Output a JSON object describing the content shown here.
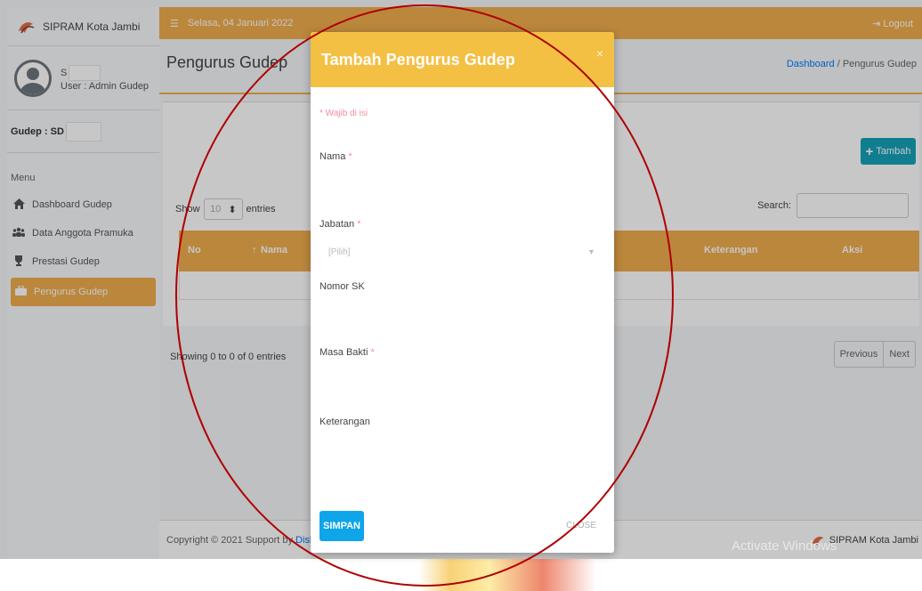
{
  "app": {
    "brand": "SIPRAM Kota Jambi"
  },
  "topbar": {
    "date": "Selasa, 04 Januari 2022",
    "logout": "Logout"
  },
  "user": {
    "name_initial": "S",
    "role": "User : Admin Gudep"
  },
  "gudep": {
    "label": "Gudep : SD"
  },
  "sidebar": {
    "header": "Menu",
    "items": [
      {
        "label": "Dashboard Gudep",
        "icon": "home-icon"
      },
      {
        "label": "Data Anggota Pramuka",
        "icon": "users-icon"
      },
      {
        "label": "Prestasi Gudep",
        "icon": "trophy-icon"
      },
      {
        "label": "Pengurus Gudep",
        "icon": "briefcase-icon",
        "active": true
      }
    ]
  },
  "page": {
    "title": "Pengurus Gudep"
  },
  "breadcrumb": {
    "home": "Dashboard",
    "separator": "/",
    "current": "Pengurus Gudep"
  },
  "toolbar": {
    "add_label": "Tambah",
    "add_icon": "+"
  },
  "datatable": {
    "show_prefix": "Show",
    "show_suffix": "entries",
    "length_value": "10",
    "search_label": "Search:",
    "columns": [
      "No",
      "Nama",
      "Keterangan",
      "Aksi"
    ],
    "info": "Showing 0 to 0 of 0 entries",
    "prev": "Previous",
    "next": "Next"
  },
  "footer": {
    "copyright": "Copyright © 2021 Support by",
    "link": "Diskominfo",
    "brand": "SIPRAM Kota Jambi"
  },
  "watermark": "Activate Windows",
  "modal": {
    "title": "Tambah Pengurus Gudep",
    "close_icon": "×",
    "required_note": "* Wajib di isi",
    "fields": {
      "nama": {
        "label": "Nama",
        "required": "*"
      },
      "jabatan": {
        "label": "Jabatan",
        "required": "*",
        "placeholder": "[Pilih]"
      },
      "nomor_sk": {
        "label": "Nomor SK"
      },
      "masa_bakti": {
        "label": "Masa Bakti",
        "required": "*"
      },
      "keterangan": {
        "label": "Keterangan"
      }
    },
    "submit": "SIMPAN",
    "close": "CLOSE"
  },
  "colors": {
    "accent": "#f0ad4e",
    "modal_header": "#f4c044",
    "primary": "#0ea5e9",
    "info": "#17a2b8",
    "annotation": "#b00000"
  }
}
